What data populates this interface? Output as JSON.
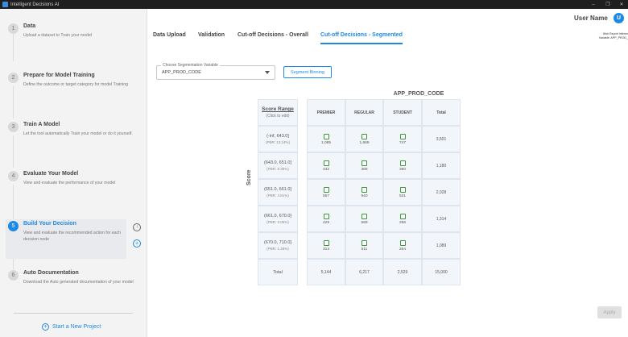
{
  "window": {
    "title": "Intelligent Decisions AI"
  },
  "steps": [
    {
      "num": "1",
      "title": "Data",
      "desc": "Upload a dataset to Train your model"
    },
    {
      "num": "2",
      "title": "Prepare for Model Training",
      "desc": "Define the outcome or target category for model Training"
    },
    {
      "num": "3",
      "title": "Train A Model",
      "desc": "Let the tool automatically Train your model or do it yourself."
    },
    {
      "num": "4",
      "title": "Evaluate Your Model",
      "desc": "View and evaluate the performance of your model"
    },
    {
      "num": "5",
      "title": "Build Your Decision",
      "desc": "View and evaluate the recommended action for each decision node"
    },
    {
      "num": "6",
      "title": "Auto Documentation",
      "desc": "Download the Auto generated documentation of your model"
    }
  ],
  "sidebar": {
    "new_project": "Start a New Project"
  },
  "header": {
    "user_name": "User Name",
    "avatar_initial": "U"
  },
  "tabs": [
    "Data Upload",
    "Validation",
    "Cut-off Decisions - Overall",
    "Cut-off Decisions - Segmented"
  ],
  "info": {
    "line1": "Wsh Report Inferen",
    "line2": "Variable: APP_PROD_"
  },
  "segmentation": {
    "label": "Choose Segmentation Variable",
    "value": "APP_PROD_CODE",
    "binning_button": "Segment Binning"
  },
  "table": {
    "group_header": "APP_PROD_CODE",
    "score_axis": "Score",
    "score_header": "Score Range",
    "score_header_sub": "(Click to edit)",
    "columns": [
      "PREMIER",
      "REGULAR",
      "STUDENT",
      "Total"
    ],
    "rows": [
      {
        "range": "(-inf, 643.0]",
        "pbr": "(PBR: 13.24%)",
        "values": [
          "1,085",
          "1,669",
          "747"
        ],
        "total": "3,501"
      },
      {
        "range": "(643.0, 651.0]",
        "pbr": "(PBR: 8.36%)",
        "values": [
          "432",
          "388",
          "360"
        ],
        "total": "1,180"
      },
      {
        "range": "(651.0, 661.0]",
        "pbr": "(PBR: 4.81%)",
        "values": [
          "557",
          "940",
          "531"
        ],
        "total": "2,028"
      },
      {
        "range": "(661.0, 670.0]",
        "pbr": "(PBR: 3.05%)",
        "values": [
          "429",
          "589",
          "296"
        ],
        "total": "1,314"
      },
      {
        "range": "(670.0, 710.0]",
        "pbr": "(PBR: 1.28%)",
        "values": [
          "314",
          "511",
          "264"
        ],
        "total": "1,089"
      }
    ],
    "total_label": "Total",
    "column_totals": [
      "5,144",
      "6,217",
      "2,529",
      "15,000"
    ]
  },
  "apply_button": "Apply"
}
